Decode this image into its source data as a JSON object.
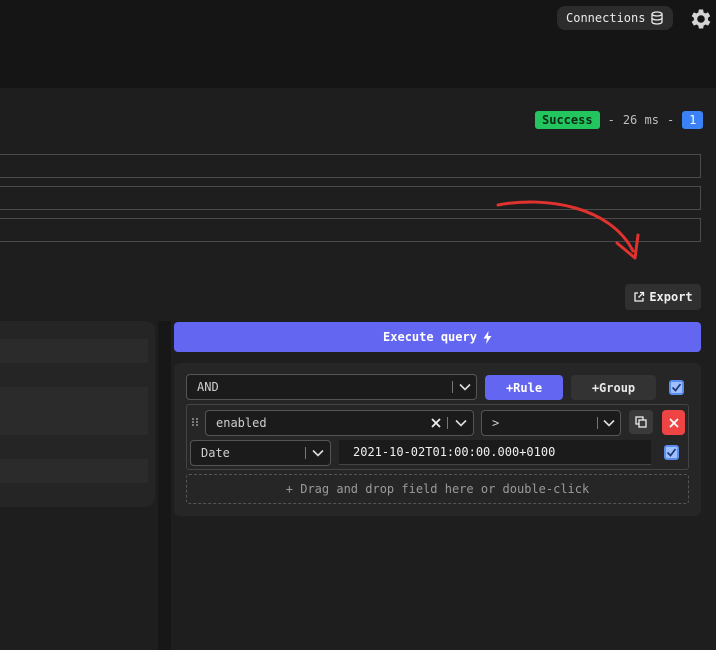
{
  "header": {
    "connections_label": "Connections",
    "connections_icon": "database-icon",
    "settings_icon": "gear-icon"
  },
  "status": {
    "result": "Success",
    "separator_1": "-",
    "duration": "26 ms",
    "separator_2": "-",
    "count": "1"
  },
  "toolbar": {
    "export_label": "Export",
    "export_icon": "external-link-icon"
  },
  "query": {
    "execute_label": "Execute query",
    "execute_icon": "lightning-icon",
    "combinator": "AND",
    "add_rule_label": "+Rule",
    "add_group_label": "+Group",
    "rule": {
      "field": "enabled",
      "operator": ">",
      "value_type": "Date",
      "value": "2021-10-02T01:00:00.000+0100"
    },
    "drop_hint": "+ Drag and drop field here or double-click"
  },
  "colors": {
    "accent": "#6366f1",
    "success": "#22c55e",
    "count_badge": "#3b82f6",
    "danger": "#ef4444",
    "annotation_arrow": "#e0322f"
  }
}
